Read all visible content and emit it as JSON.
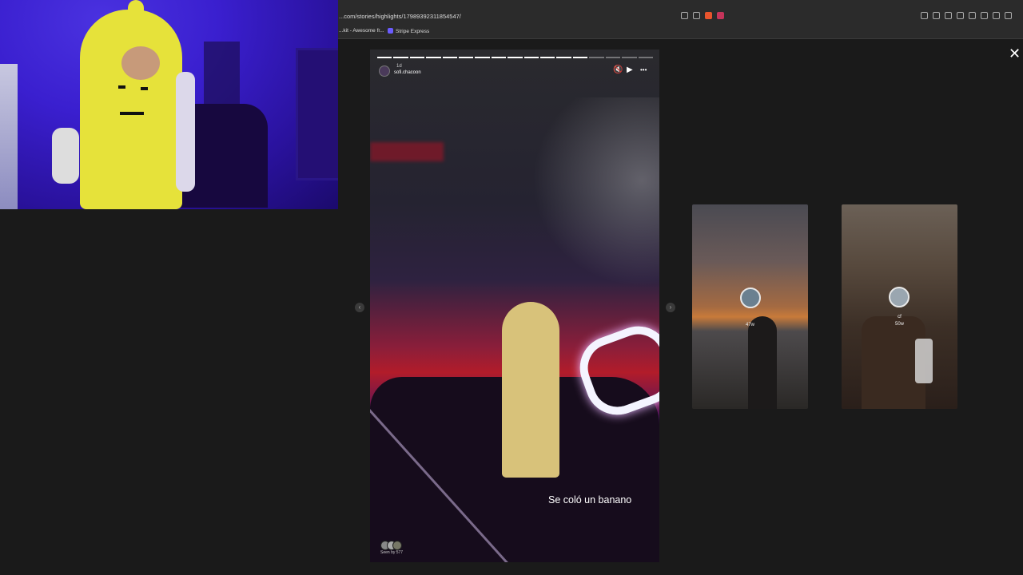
{
  "browser": {
    "url": "...com/stories/highlights/17989392311854547/",
    "bookmarks": [
      "...kit - Awesome fr...",
      "Stripe Express"
    ]
  },
  "story": {
    "time": "1d",
    "username": "sofi.chacoon",
    "progress": {
      "segments": 17,
      "completed": 13
    },
    "caption": "Se coló un banano",
    "seen_by": "Seen by 577",
    "controls": {
      "mute": "🔇",
      "play": "▶",
      "more": "•••"
    }
  },
  "next_stories": [
    {
      "name": "",
      "age": "47w"
    },
    {
      "name": "cf",
      "age": "50w"
    }
  ],
  "close_label": "✕",
  "nav": {
    "prev": "‹",
    "next": "›"
  }
}
